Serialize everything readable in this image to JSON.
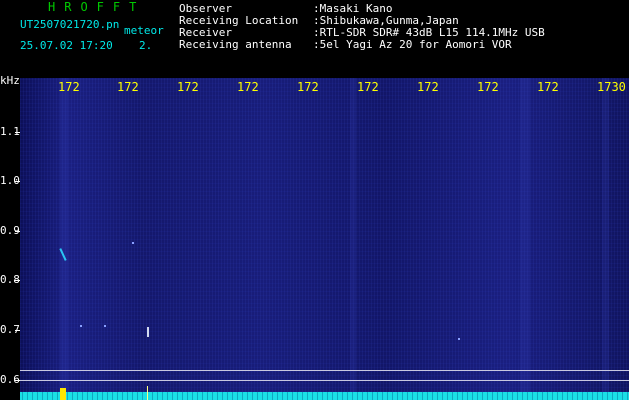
{
  "header": {
    "logo": "HROFFT",
    "filename": "UT2507021720.pn",
    "meteor_label": "meteor",
    "datetime": "25.07.02 17:20",
    "count": "2."
  },
  "info": [
    {
      "label": "Observer",
      "value": ":Masaki Kano"
    },
    {
      "label": "Receiving Location",
      "value": ":Shibukawa,Gunma,Japan"
    },
    {
      "label": "Receiver",
      "value": ":RTL-SDR SDR# 43dB L15 114.1MHz USB"
    },
    {
      "label": "Receiving antenna",
      "value": ":5el Yagi Az 20 for Aomori VOR"
    }
  ],
  "axis": {
    "y_unit": "kHz",
    "y_ticks": [
      "1.1",
      "1.0",
      "0.9",
      "0.8",
      "0.7",
      "0.6"
    ],
    "x_ticks": [
      "172",
      "172",
      "172",
      "172",
      "172",
      "172",
      "172",
      "172",
      "172",
      "1730"
    ]
  },
  "colors": {
    "background": "#000000",
    "spectrogram": "#161a74",
    "logo": "#00c800",
    "filename": "#00e8e8",
    "x_ticks": "#ffff00",
    "meteor": "#2bd6ff",
    "baseline": "#1ae0e6"
  }
}
